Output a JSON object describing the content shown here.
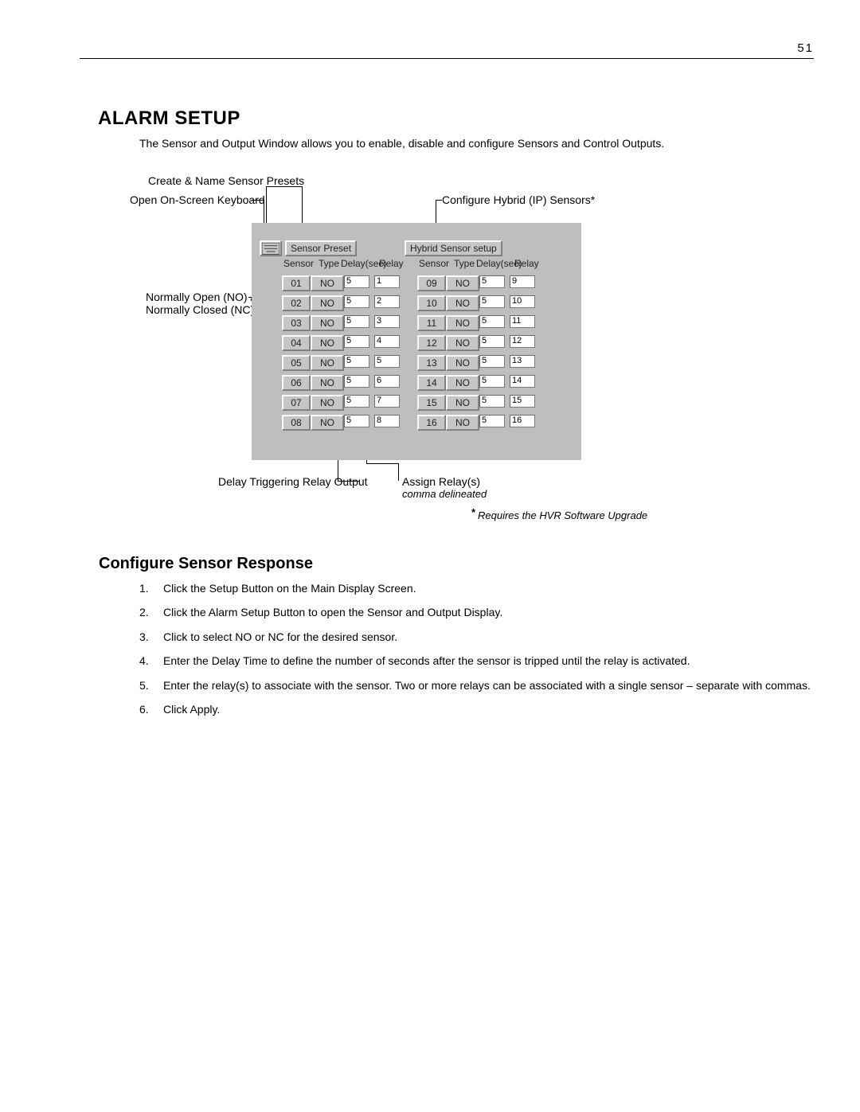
{
  "page_number": "51",
  "title": "ALARM SETUP",
  "intro": "The Sensor and Output Window allows you to enable, disable and configure Sensors and Control Outputs.",
  "callouts": {
    "create_presets": "Create & Name Sensor Presets",
    "open_keyboard": "Open On-Screen Keyboard",
    "hybrid": "Configure Hybrid (IP) Sensors*",
    "nonc_line1": "Normally Open (NO) /",
    "nonc_line2": "Normally Closed (NC)",
    "delay_trigger": "Delay Triggering Relay Output",
    "assign_relays": "Assign Relay(s)",
    "comma_note": "comma delineated",
    "footnote": "Requires the HVR Software Upgrade"
  },
  "panel": {
    "sensor_preset_btn": "Sensor Preset",
    "hybrid_btn": "Hybrid Sensor setup",
    "headers": {
      "sensor": "Sensor",
      "type": "Type",
      "delay": "Delay(sec)",
      "relay": "Relay"
    },
    "left_rows": [
      {
        "sensor": "01",
        "type": "NO",
        "delay": "5",
        "relay": "1"
      },
      {
        "sensor": "02",
        "type": "NO",
        "delay": "5",
        "relay": "2"
      },
      {
        "sensor": "03",
        "type": "NO",
        "delay": "5",
        "relay": "3"
      },
      {
        "sensor": "04",
        "type": "NO",
        "delay": "5",
        "relay": "4"
      },
      {
        "sensor": "05",
        "type": "NO",
        "delay": "5",
        "relay": "5"
      },
      {
        "sensor": "06",
        "type": "NO",
        "delay": "5",
        "relay": "6"
      },
      {
        "sensor": "07",
        "type": "NO",
        "delay": "5",
        "relay": "7"
      },
      {
        "sensor": "08",
        "type": "NO",
        "delay": "5",
        "relay": "8"
      }
    ],
    "right_rows": [
      {
        "sensor": "09",
        "type": "NO",
        "delay": "5",
        "relay": "9"
      },
      {
        "sensor": "10",
        "type": "NO",
        "delay": "5",
        "relay": "10"
      },
      {
        "sensor": "11",
        "type": "NO",
        "delay": "5",
        "relay": "11"
      },
      {
        "sensor": "12",
        "type": "NO",
        "delay": "5",
        "relay": "12"
      },
      {
        "sensor": "13",
        "type": "NO",
        "delay": "5",
        "relay": "13"
      },
      {
        "sensor": "14",
        "type": "NO",
        "delay": "5",
        "relay": "14"
      },
      {
        "sensor": "15",
        "type": "NO",
        "delay": "5",
        "relay": "15"
      },
      {
        "sensor": "16",
        "type": "NO",
        "delay": "5",
        "relay": "16"
      }
    ]
  },
  "section_heading": "Configure Sensor Response",
  "steps": [
    "Click the Setup Button on the Main Display Screen.",
    "Click the Alarm Setup Button to open the Sensor and Output Display.",
    "Click to select NO or NC for the desired sensor.",
    "Enter the Delay Time to define the number of seconds after the sensor is tripped until the relay is activated.",
    "Enter the relay(s) to associate with the sensor.  Two or more relays can be associated with a single sensor – separate with commas.",
    "Click Apply."
  ]
}
